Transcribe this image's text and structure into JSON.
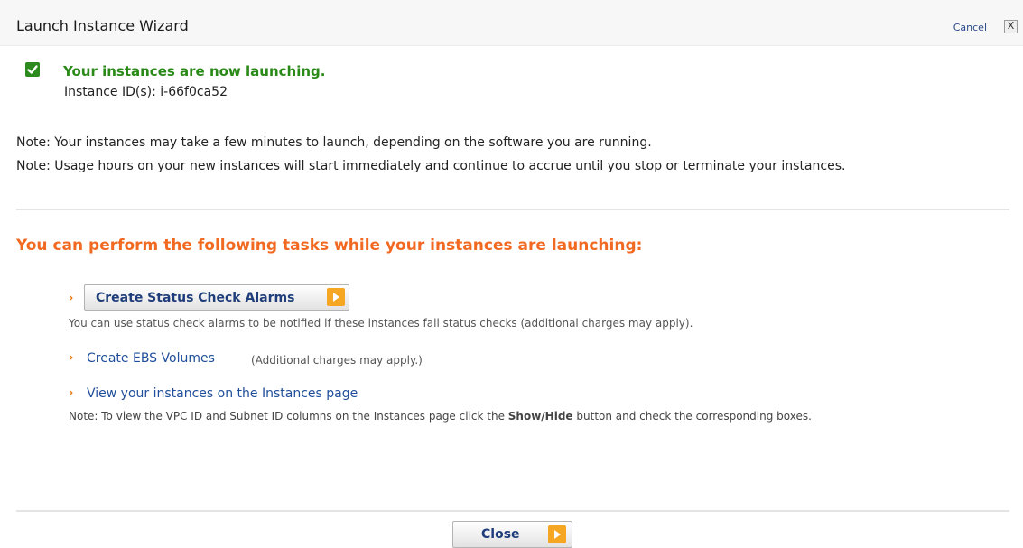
{
  "window": {
    "title": "Launch Instance Wizard",
    "cancel_label": "Cancel",
    "close_x": "X"
  },
  "status": {
    "message": "Your instances are now launching.",
    "instance_id_label": "Instance ID(s): i-66f0ca52"
  },
  "notes": [
    "Note: Your instances may take a few minutes to launch, depending on the software you are running.",
    "Note: Usage hours on your new instances will start immediately and continue to accrue until you stop or terminate your instances."
  ],
  "tasks": {
    "heading": "You can perform the following tasks while your instances are launching:",
    "alarms_button": "Create Status Check Alarms",
    "alarms_desc": "You can use status check alarms to be notified if these instances fail status checks (additional charges may apply).",
    "ebs_link": "Create EBS Volumes",
    "ebs_desc": "(Additional charges may apply.)",
    "instances_link": "View your instances on the Instances page",
    "instances_note_pre": "Note: To view the VPC ID and Subnet ID columns on the Instances page click the ",
    "instances_note_bold": "Show/Hide",
    "instances_note_post": " button and check the corresponding boxes."
  },
  "footer": {
    "close_button": "Close"
  },
  "colors": {
    "success": "#2a8a17",
    "accent": "#f26a21",
    "link": "#1f4e9a",
    "play": "#f5a623"
  },
  "icons": {
    "check": "checkbox-check-icon",
    "arrow": "chevron-right-icon",
    "play": "play-arrow-icon"
  }
}
